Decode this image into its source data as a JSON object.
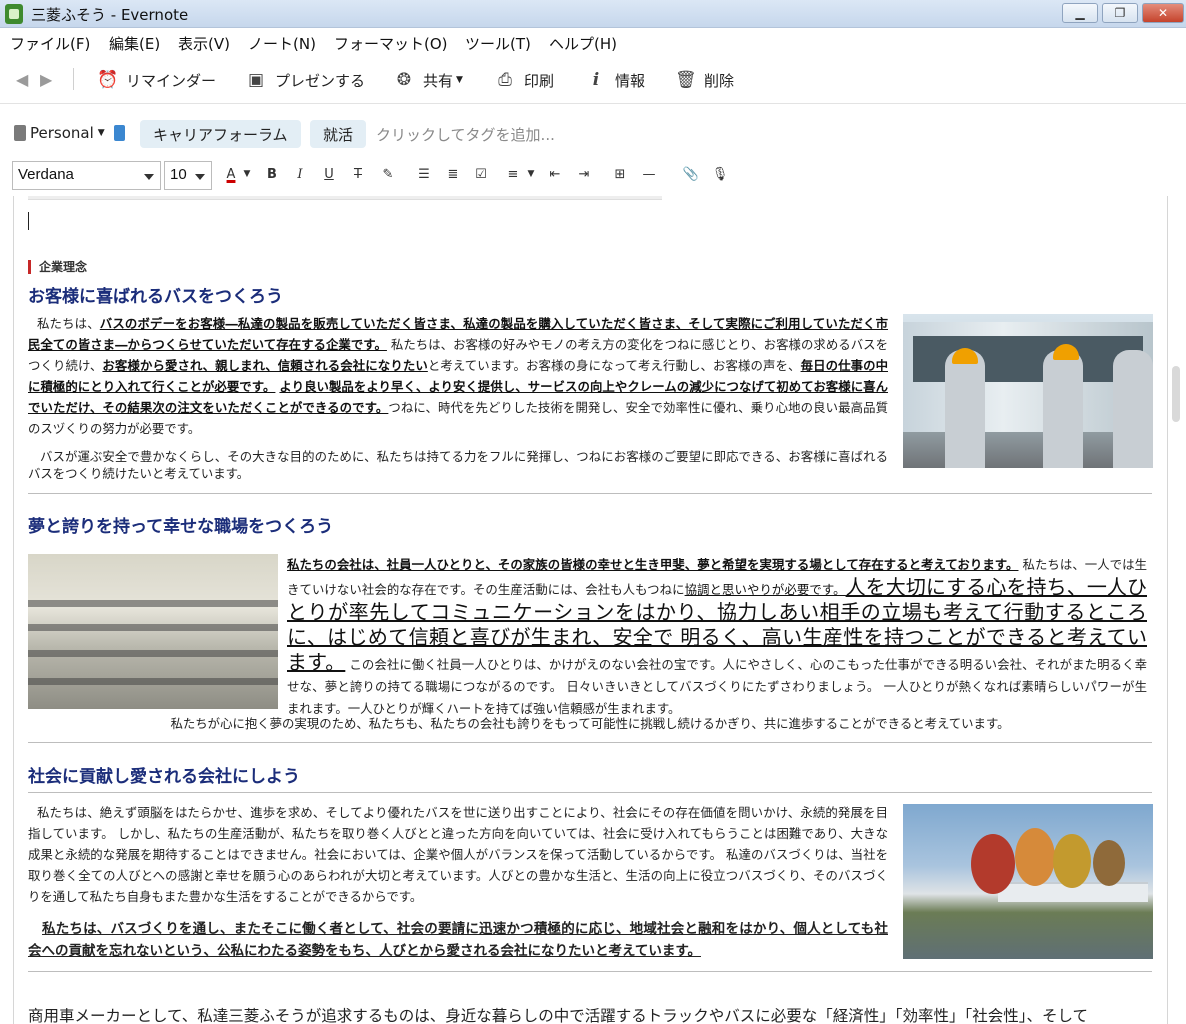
{
  "window": {
    "title": "三菱ふそう - Evernote",
    "minimize_label": "▁",
    "maximize_label": "❐",
    "close_label": "✕"
  },
  "menu": [
    "ファイル(F)",
    "編集(E)",
    "表示(V)",
    "ノート(N)",
    "フォーマット(O)",
    "ツール(T)",
    "ヘルプ(H)"
  ],
  "toolbar": {
    "reminder": "リマインダー",
    "present": "プレゼンする",
    "share": "共有",
    "print": "印刷",
    "info": "情報",
    "delete": "削除"
  },
  "tags": {
    "notebook": "Personal",
    "items": [
      "キャリアフォーラム",
      "就活"
    ],
    "placeholder": "クリックしてタグを追加..."
  },
  "format": {
    "font": "Verdana",
    "size": "10"
  },
  "note": {
    "section_label": "企業理念",
    "s1": {
      "title": "お客様に喜ばれるバスをつくろう",
      "p1_a": "私たちは、",
      "p1_u1": "バスのボデーをお客様―私達の製品を販売していただく皆さま、私達の製品を購入していただく皆さま、そして実際にご利用していただく市民全ての皆さま―からつくらせていただいて存在する企業です。",
      "p1_b": " 私たちは、お客様の好みやモノの考え方の変化をつねに感じとり、お客様の求めるバスをつくり続け、",
      "p1_u2": "お客様から愛され、親しまれ、信頼される会社になりたい",
      "p1_c": "と考えています。お客様の身になって考え行動し、お客様の声を、",
      "p1_u3": "毎日の仕事の中に積極的にとり入れて行くことが必要です。",
      "p1_d": " ",
      "p1_u4": "より良い製品をより早く、より安く提供し、サービスの向上やクレームの減少につなげて初めてお客様に喜んでいただけ、その結果次の注文をいただくことができるのです。",
      "p1_e": "つねに、時代を先どりした技術を開発し、安全で効率性に優れ、乗り心地の良い最高品質のスヅくりの努力が必要です。",
      "p2": "バスが運ぶ安全で豊かなくらし、その大きな目的のために、私たちは持てる力をフルに発揮し、つねにお客様のご要望に即応できる、お客様に喜ばれるバスをつくり続けたいと考えています。"
    },
    "s2": {
      "title": "夢と誇りを持って幸せな職場をつくろう",
      "p1_u1": "私たちの会社は、社員一人ひとりと、その家族の皆様の幸せと生き甲斐、夢と希望を実現する場として存在すると考えております。",
      "p1_a": " 私たちは、一人では生きていけない社会的な存在です。その生産活動には、会社も人もつねに",
      "p1_u2": "協調と思いやりが必要です。",
      "p1_big": "人を大切にする心を持ち、一人ひとりが率先してコミュニケーションをはかり、協力しあい相手の立場も考えて行動するところに、はじめて信頼と喜びが生まれ、安全で 明るく、高い生産性を持つことができると考えています。",
      "p1_b": " この会社に働く社員一人ひとりは、かけがえのない会社の宝です。人にやさしく、心のこもった仕事ができる明るい会社、それがまた明るく幸せな、夢と誇りの持てる職場につながるのです。 日々いきいきとしてバスづくりにたずさわりましょう。 一人ひとりが熱くなれば素晴らしいパワーが生まれます。一人ひとりが輝くハートを持てば強い信頼感が生まれます。",
      "p2": "私たちが心に抱く夢の実現のため、私たちも、私たちの会社も誇りをもって可能性に挑戦し続けるかぎり、共に進歩することができると考えています。"
    },
    "s3": {
      "title": "社会に貢献し愛される会社にしよう",
      "p1": "私たちは、絶えず頭脳をはたらかせ、進歩を求め、そしてより優れたバスを世に送り出すことにより、社会にその存在価値を問いかけ、永続的発展を目指しています。 しかし、私たちの生産活動が、私たちを取り巻く人びとと違った方向を向いていては、社会に受け入れてもらうことは困難であり、大きな成果と永続的な発展を期待することはできません。社会においては、企業や個人がバランスを保って活動しているからです。 私達のバスづくりは、当社を取り巻く全ての人びとへの感謝と幸せを願う心のあらわれが大切と考えています。人びとの豊かな生活と、生活の向上に役立つバスづくり、そのバスづくりを通して私たち自身もまた豊かな生活をすることができるからです。",
      "p2": "私たちは、バスづくりを通し、またそこに働く者として、社会の要請に迅速かつ積極的に応じ、地域社会と融和をはかり、個人としても社会への貢献を忘れないという、公私にわたる姿勢をもち、人びとから愛される会社になりたいと考えています。"
    },
    "footer_line": "商用車メーカーとして、私達三菱ふそうが追求するものは、身近な暮らしの中で活躍するトラックやバスに必要な「経済性」「効率性」「社会性」、そして"
  }
}
